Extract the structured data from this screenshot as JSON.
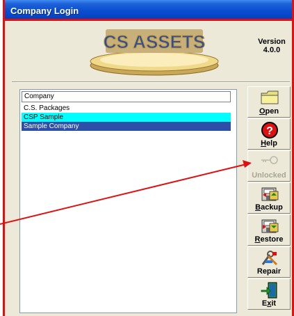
{
  "window": {
    "title": "Company Login"
  },
  "logo": {
    "text": "CS ASSETS"
  },
  "version": {
    "label": "Version",
    "number": "4.0.0"
  },
  "list": {
    "column_header": "Company",
    "rows": [
      "C.S. Packages",
      "CSP Sample",
      "Sample Company"
    ]
  },
  "buttons": {
    "open": {
      "pre": "",
      "key": "O",
      "post": "pen",
      "icon": "folder-icon"
    },
    "help": {
      "pre": "",
      "key": "H",
      "post": "elp",
      "icon": "question-icon"
    },
    "unlocked": {
      "label": "Unlocked",
      "icon": "key-icon",
      "disabled": true
    },
    "backup": {
      "pre": "",
      "key": "B",
      "post": "ackup",
      "icon": "backup-icon"
    },
    "restore": {
      "pre": "",
      "key": "R",
      "post": "estore",
      "icon": "restore-icon"
    },
    "repair": {
      "label": "Repair",
      "icon": "repair-icon"
    },
    "exit": {
      "pre": "E",
      "key": "x",
      "post": "it",
      "icon": "exit-door-icon"
    }
  },
  "colors": {
    "accent_red": "#e01010",
    "titlebar": "#0a4fd0",
    "selection": "#2e4fa8",
    "highlight": "#00ffff"
  }
}
